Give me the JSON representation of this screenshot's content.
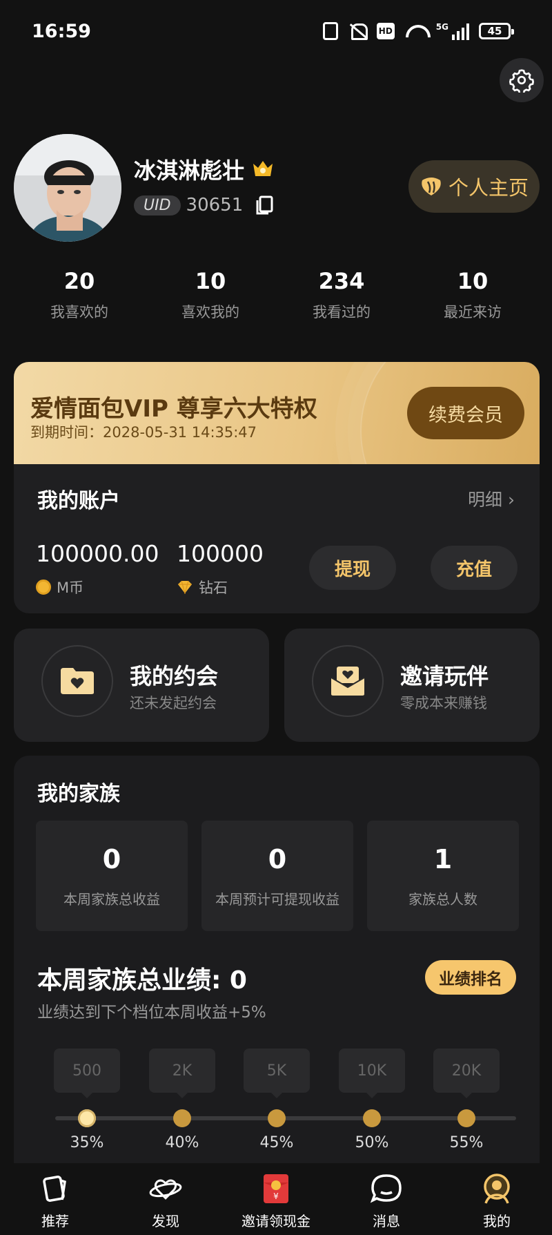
{
  "status_bar": {
    "time": "16:59",
    "network": "5G",
    "battery": "45"
  },
  "profile": {
    "nickname": "冰淇淋彪壮",
    "uid_label": "UID",
    "uid": "30651",
    "homepage_label": "个人主页"
  },
  "stats": [
    {
      "value": "20",
      "label": "我喜欢的"
    },
    {
      "value": "10",
      "label": "喜欢我的"
    },
    {
      "value": "234",
      "label": "我看过的"
    },
    {
      "value": "10",
      "label": "最近来访"
    }
  ],
  "vip": {
    "title": "爱情面包VIP 尊享六大特权",
    "expire": "到期时间：2028-05-31 14:35:47",
    "renew_label": "续费会员"
  },
  "account": {
    "title": "我的账户",
    "detail_label": "明细",
    "coins_value": "100000.00",
    "coins_unit": "M币",
    "diamonds_value": "100000",
    "diamonds_unit": "钻石",
    "withdraw_label": "提现",
    "recharge_label": "充值"
  },
  "quick": [
    {
      "title": "我的约会",
      "subtitle": "还未发起约会"
    },
    {
      "title": "邀请玩伴",
      "subtitle": "零成本来赚钱"
    }
  ],
  "family": {
    "title": "我的家族",
    "stats": [
      {
        "value": "0",
        "label": "本周家族总收益"
      },
      {
        "value": "0",
        "label": "本周预计可提现收益"
      },
      {
        "value": "1",
        "label": "家族总人数"
      }
    ],
    "performance_title": "本周家族总业绩: 0",
    "performance_subtitle": "业绩达到下个档位本周收益+5%",
    "rank_label": "业绩排名",
    "tiers": [
      {
        "threshold": "500",
        "percent": "35%"
      },
      {
        "threshold": "2K",
        "percent": "40%"
      },
      {
        "threshold": "5K",
        "percent": "45%"
      },
      {
        "threshold": "10K",
        "percent": "50%"
      },
      {
        "threshold": "20K",
        "percent": "55%"
      }
    ]
  },
  "tabbar": [
    {
      "label": "推荐",
      "icon": "cards-icon"
    },
    {
      "label": "发现",
      "icon": "planet-icon"
    },
    {
      "label": "邀请领现金",
      "icon": "red-envelope-icon"
    },
    {
      "label": "消息",
      "icon": "chat-bubble-icon"
    },
    {
      "label": "我的",
      "icon": "profile-icon",
      "active": true
    }
  ],
  "colors": {
    "accent": "#f4c56a",
    "background": "#121212",
    "card": "#1f1f21",
    "vip_gold": "#e9c584"
  }
}
